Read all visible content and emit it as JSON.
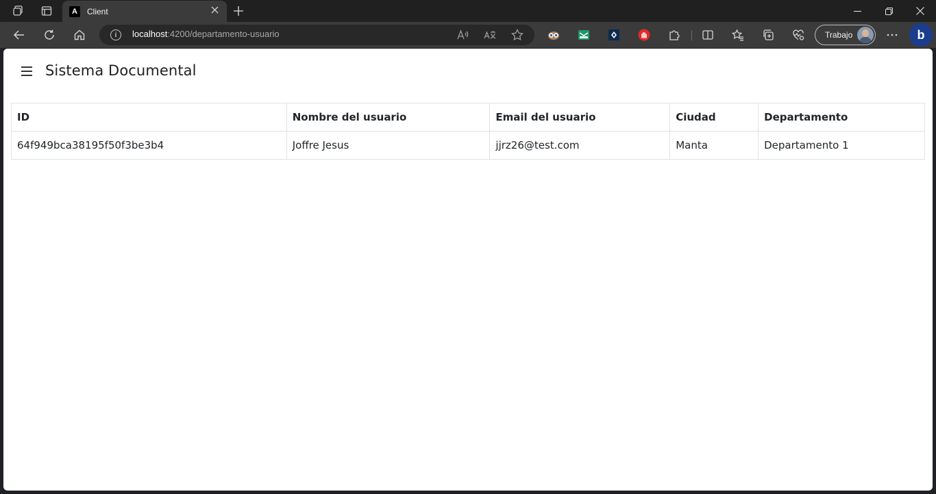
{
  "browser": {
    "tab": {
      "title": "Client",
      "favicon_letter": "A"
    },
    "address": {
      "host": "localhost",
      "rest": ":4200/departamento-usuario"
    },
    "profile": {
      "label": "Trabajo"
    },
    "icons": {
      "workspaces": "workspaces-icon",
      "tab_actions": "tab-actions-icon",
      "close_tab": "close-icon",
      "new_tab": "plus-icon",
      "minimize": "minimize-icon",
      "restore": "restore-icon",
      "close_window": "close-icon",
      "back": "back-arrow-icon",
      "refresh": "refresh-icon",
      "home": "home-icon",
      "info": "info-icon",
      "read_aloud": "read-aloud-icon",
      "translate": "translate-icon",
      "favorite": "star-icon",
      "extensions": "puzzle-icon",
      "split_screen": "split-screen-icon",
      "favorites": "favorites-icon",
      "collections": "collections-icon",
      "performance": "heart-pulse-icon",
      "more": "more-dots-icon",
      "bing": "bing-icon"
    }
  },
  "app": {
    "title": "Sistema Documental",
    "table": {
      "headers": [
        "ID",
        "Nombre del usuario",
        "Email del usuario",
        "Ciudad",
        "Departamento"
      ],
      "rows": [
        [
          "64f949bca38195f50f3be3b4",
          "Joffre Jesus",
          "jjrz26@test.com",
          "Manta",
          "Departamento 1"
        ]
      ]
    }
  }
}
